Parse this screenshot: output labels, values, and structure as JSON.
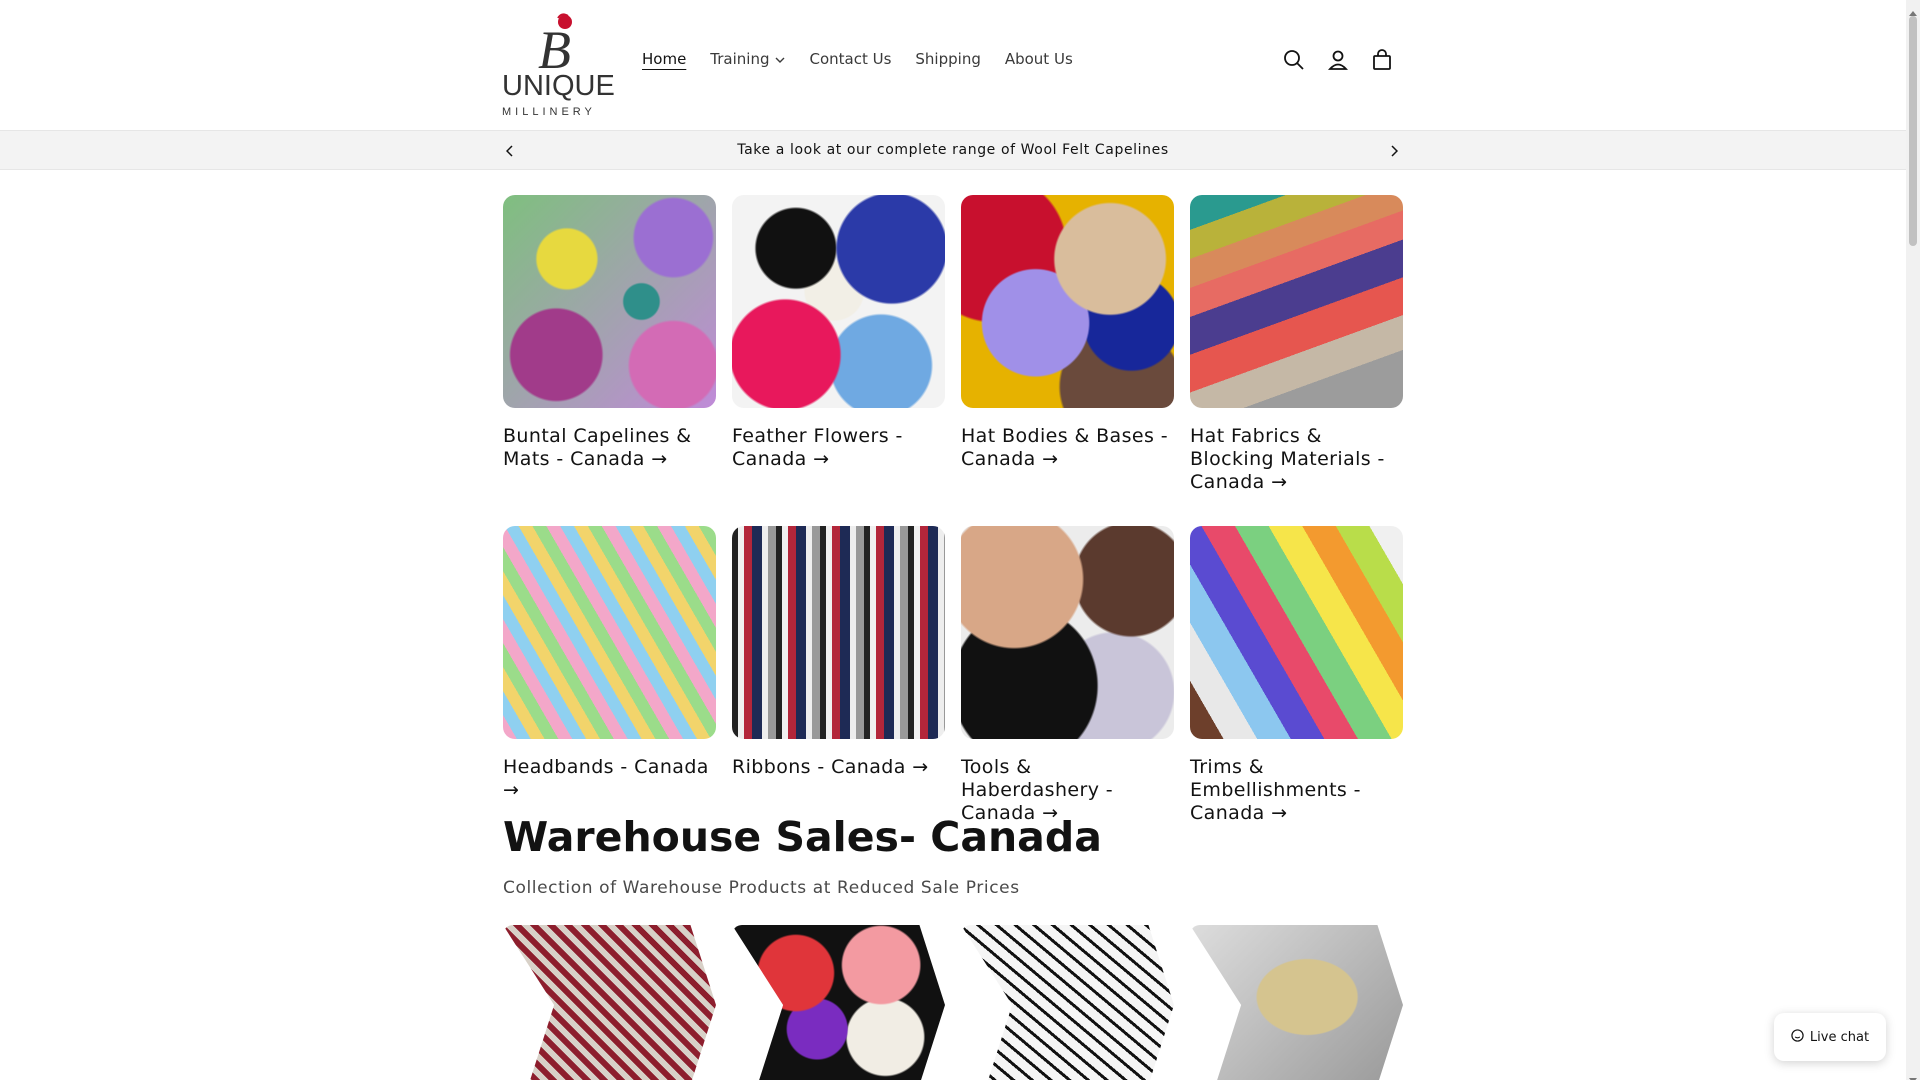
{
  "brand": {
    "word": "UNIQUE",
    "sub": "MILLINERY",
    "mark_letter": "B"
  },
  "nav": [
    {
      "label": "Home"
    },
    {
      "label": "Training"
    },
    {
      "label": "Contact Us"
    },
    {
      "label": "Shipping"
    },
    {
      "label": "About Us"
    }
  ],
  "icons": {
    "search": "search-icon",
    "account": "account-icon",
    "cart": "cart-icon"
  },
  "announcement": {
    "text": "Take a look at our complete range of Wool Felt Capelines"
  },
  "collections": [
    {
      "title": "Buntal Capelines & Mats - Canada →"
    },
    {
      "title": "Feather Flowers - Canada →"
    },
    {
      "title": "Hat Bodies & Bases - Canada →"
    },
    {
      "title": "Hat Fabrics & Blocking Materials - Canada →"
    },
    {
      "title": "Headbands - Canada →"
    },
    {
      "title": "Ribbons - Canada →"
    },
    {
      "title": "Tools & Haberdashery - Canada →"
    },
    {
      "title": "Trims & Embellishments - Canada →"
    }
  ],
  "warehouse": {
    "title": "Warehouse Sales- Canada",
    "subtitle": "Collection of Warehouse Products at Reduced Sale Prices"
  },
  "chat": {
    "label": "Live chat"
  },
  "colors": {
    "text": "#121212",
    "announce_bg": "#f3f3f3",
    "logo_red": "#c8102e"
  }
}
